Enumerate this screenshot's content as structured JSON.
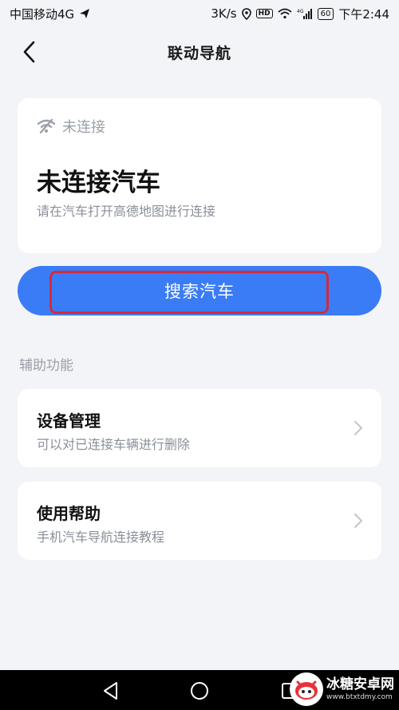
{
  "status_bar": {
    "carrier": "中国移动4G",
    "speed": "3K/s",
    "hd": "HD",
    "signal_label": "4G",
    "battery": "60",
    "time": "下午2:44"
  },
  "header": {
    "title": "联动导航"
  },
  "connection": {
    "status_label": "未连接",
    "title": "未连接汽车",
    "subtitle": "请在汽车打开高德地图进行连接"
  },
  "search_button": {
    "label": "搜索汽车"
  },
  "section": {
    "label": "辅助功能"
  },
  "items": [
    {
      "title": "设备管理",
      "subtitle": "可以对已连接车辆进行删除"
    },
    {
      "title": "使用帮助",
      "subtitle": "手机汽车导航连接教程"
    }
  ],
  "watermark": {
    "name": "冰糖安卓网",
    "url": "www.btxtdmy.com"
  },
  "colors": {
    "accent": "#3a7cf6",
    "highlight": "#d42a3c",
    "background": "#f3f4f8"
  }
}
